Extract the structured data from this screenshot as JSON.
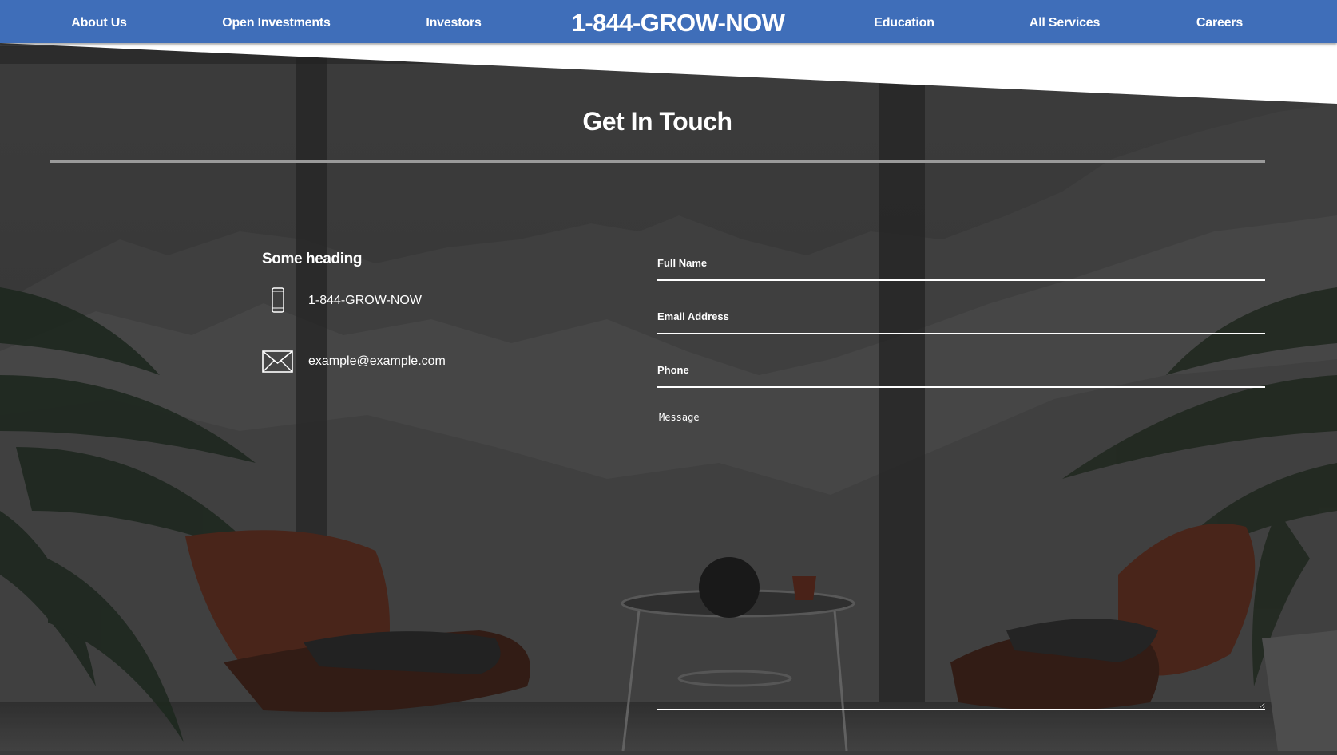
{
  "nav": {
    "items": [
      {
        "label": "About Us"
      },
      {
        "label": "Open Investments"
      },
      {
        "label": "Investors"
      },
      {
        "label": "Education"
      },
      {
        "label": "All Services"
      },
      {
        "label": "Careers"
      }
    ],
    "brand": "1-844-GROW-NOW",
    "bar_color": "#3f6eb9"
  },
  "contact": {
    "title": "Get In Touch",
    "info": {
      "heading": "Some heading",
      "phone": "1-844-GROW-NOW",
      "phone_icon": "mobile-phone-icon",
      "email": "example@example.com",
      "email_icon": "envelope-icon"
    },
    "form": {
      "full_name_label": "Full Name",
      "email_label": "Email Address",
      "phone_label": "Phone",
      "message_placeholder": "Message"
    }
  }
}
